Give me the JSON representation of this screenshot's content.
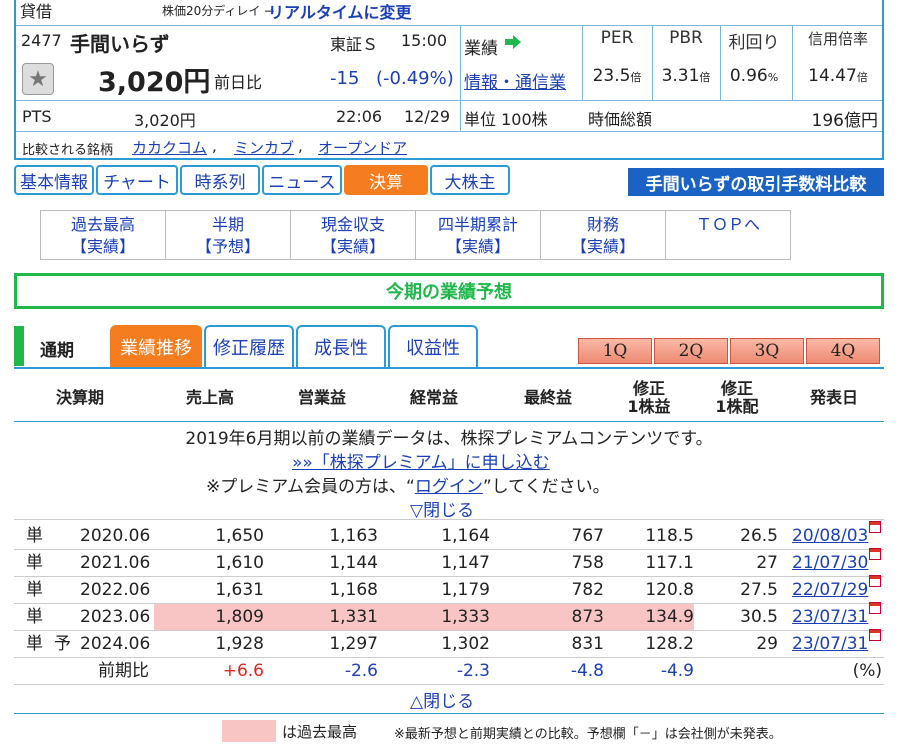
{
  "header": {
    "margin_label": "貸借",
    "delay_note": "株価20分ディレイ →",
    "realtime_link": "リアルタイムに変更",
    "code": "2477",
    "name": "手間いらず",
    "market": "東証Ｓ",
    "time": "15:00",
    "price": "3,020円",
    "change_label": "前日比",
    "change": "-15",
    "change_pct": "(-0.49%)",
    "pts_label": "PTS",
    "pts_price": "3,020円",
    "pts_time": "22:06",
    "pts_date": "12/29",
    "perf_label": "業績",
    "sector": "情報・通信業",
    "unit": "単位 100株",
    "market_cap_label": "時価総額",
    "market_cap": "196億円",
    "compare_label": "比較される銘柄",
    "compare": [
      "カカクコム",
      "ミンカブ",
      "オープンドア"
    ],
    "fin_headers": [
      "PER",
      "PBR",
      "利回り",
      "信用倍率"
    ],
    "fin_values": [
      {
        "v": "23.5",
        "u": "倍"
      },
      {
        "v": "3.31",
        "u": "倍"
      },
      {
        "v": "0.96",
        "u": "%"
      },
      {
        "v": "14.47",
        "u": "倍"
      }
    ]
  },
  "tabs": [
    "基本情報",
    "チャート",
    "時系列",
    "ニュース",
    "決算",
    "大株主"
  ],
  "fee_banner": "手間いらずの取引手数料比較",
  "subtabs": [
    {
      "a": "過去最高",
      "b": "【実績】"
    },
    {
      "a": "半期",
      "b": "【予想】"
    },
    {
      "a": "現金収支",
      "b": "【実績】"
    },
    {
      "a": "四半期累計",
      "b": "【実績】"
    },
    {
      "a": "財務",
      "b": "【実績】"
    },
    {
      "a": "ＴＯＰへ",
      "b": ""
    }
  ],
  "section_title": "今期の業績予想",
  "period_label": "通期",
  "tabs2": [
    "業績推移",
    "修正履歴",
    "成長性",
    "収益性"
  ],
  "quarters": [
    "1Q",
    "2Q",
    "3Q",
    "4Q"
  ],
  "table": {
    "headers": [
      {
        "a": "決算期",
        "b": ""
      },
      {
        "a": "売上高",
        "b": ""
      },
      {
        "a": "営業益",
        "b": ""
      },
      {
        "a": "経常益",
        "b": ""
      },
      {
        "a": "最終益",
        "b": ""
      },
      {
        "a": "修正",
        "b": "1株益"
      },
      {
        "a": "修正",
        "b": "1株配"
      },
      {
        "a": "発表日",
        "b": ""
      }
    ],
    "premium_note": "2019年6月期以前の業績データは、株探プレミアムコンテンツです。",
    "premium_link": "»»「株探プレミアム」に申し込む",
    "login_pre": "※プレミアム会員の方は、“",
    "login_link": "ログイン",
    "login_post": "”してください。",
    "close_top": "▽閉じる",
    "rows": [
      {
        "kind": "単",
        "yoso": "",
        "period": "2020.06",
        "sales": "1,650",
        "op": "1,163",
        "ord": "1,164",
        "net": "767",
        "eps": "118.5",
        "div": "26.5",
        "date": "20/08/03",
        "hl": false
      },
      {
        "kind": "単",
        "yoso": "",
        "period": "2021.06",
        "sales": "1,610",
        "op": "1,144",
        "ord": "1,147",
        "net": "758",
        "eps": "117.1",
        "div": "27",
        "date": "21/07/30",
        "hl": false
      },
      {
        "kind": "単",
        "yoso": "",
        "period": "2022.06",
        "sales": "1,631",
        "op": "1,168",
        "ord": "1,179",
        "net": "782",
        "eps": "120.8",
        "div": "27.5",
        "date": "22/07/29",
        "hl": false
      },
      {
        "kind": "単",
        "yoso": "",
        "period": "2023.06",
        "sales": "1,809",
        "op": "1,331",
        "ord": "1,333",
        "net": "873",
        "eps": "134.9",
        "div": "30.5",
        "date": "23/07/31",
        "hl": true
      },
      {
        "kind": "単",
        "yoso": "予",
        "period": "2024.06",
        "sales": "1,928",
        "op": "1,297",
        "ord": "1,302",
        "net": "831",
        "eps": "128.2",
        "div": "29",
        "date": "23/07/31",
        "hl": false
      }
    ],
    "yoy": {
      "label": "前期比",
      "sales": "+6.6",
      "op": "-2.6",
      "ord": "-2.3",
      "net": "-4.8",
      "eps": "-4.9",
      "unit": "(%)"
    },
    "close_bottom": "△閉じる"
  },
  "footer": {
    "legend": "は過去最高",
    "note": "※最新予想と前期実績との比較。予想欄「－」は会社側が未発表。"
  },
  "colors": {
    "accent": "#2b9bd6",
    "orange": "#f57c1f",
    "green": "#1fb84a",
    "red": "#e0261b",
    "blue": "#1a3fb8",
    "highlight": "#f9c4c4"
  }
}
